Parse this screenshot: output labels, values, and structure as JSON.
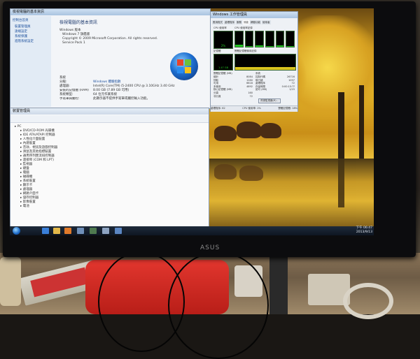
{
  "system_window": {
    "title": "檢視電腦的基本資訊",
    "section_edition": "Windows 版本",
    "edition": "Windows 7 旗艦版",
    "copyright": "Copyright © 2009 Microsoft Corporation. All rights reserved.",
    "service_pack": "Service Pack 1",
    "section_system": "系統",
    "rating_label": "分級:",
    "rating_value": "Windows 體驗指數",
    "processor_label": "處理器:",
    "processor_value": "Intel(R) Core(TM) i5-2400 CPU @ 3.10GHz 3.40 GHz",
    "memory_label": "安裝的記憶體 (RAM):",
    "memory_value": "8.00 GB (7.89 GB 可用)",
    "type_label": "系統類型:",
    "type_value": "64 位元作業系統",
    "pen_label": "手寫筆與觸控:",
    "pen_value": "此顯示器不提供手寫筆或觸控輸入功能。",
    "sidebar": [
      "控制台首頁",
      "裝置管理員",
      "遠端設定",
      "系統保護",
      "進階系統設定"
    ]
  },
  "device_manager": {
    "title": "裝置管理員",
    "items": [
      "DVD/CD-ROM 光碟機",
      "IDE ATA/ATAPI 控制器",
      "人性化介面裝置",
      "內建裝置",
      "音效、視訊及遊戲控制器",
      "滑鼠及其他指標裝置",
      "通用序列匯流排控制器",
      "連接埠 (COM 和 LPT)",
      "監視器",
      "鍵盤",
      "電腦",
      "磁碟機",
      "系統裝置",
      "顯示卡",
      "處理器",
      "網路介面卡",
      "儲存控制器",
      "影像裝置",
      "電池"
    ]
  },
  "task_manager": {
    "title": "Windows 工作管理員",
    "tabs": [
      "應用程式",
      "處理程序",
      "服務",
      "效能",
      "網路功能",
      "使用者"
    ],
    "cpu_usage_label": "CPU 使用率",
    "cpu_history_label": "CPU 使用率記錄",
    "cpu_usage_value": "2%",
    "memory_label": "記憶體",
    "memory_history_label": "實體記憶體使用記錄",
    "memory_value": "1.47 GB",
    "phys_label": "實體記憶體 (MB)",
    "phys_rows": [
      [
        "總計",
        "8084"
      ],
      [
        "快取",
        "1280"
      ],
      [
        "可用",
        "6618"
      ],
      [
        "未使用",
        "4892"
      ]
    ],
    "system_label": "系統",
    "system_rows": [
      [
        "控制代碼",
        "26716"
      ],
      [
        "執行緒",
        "1097"
      ],
      [
        "處理程序",
        "72"
      ],
      [
        "存留時間",
        "0:00:15:??"
      ],
      [
        "認可 (MB)",
        "1/15"
      ]
    ],
    "kernel_label": "核心記憶體 (MB)",
    "kernel_rows": [
      [
        "分頁",
        "160"
      ],
      [
        "非分頁",
        "72"
      ]
    ],
    "resource_button": "資源監視器(R)...",
    "status_processes": "處理程序: 62",
    "status_cpu": "CPU 使用率: 2%",
    "status_memory": "實體記憶體: 18%",
    "cpu_history": [
      0.12,
      0.05,
      0.08,
      0.03,
      0.1,
      0.04
    ],
    "mem_history": [
      0.18,
      0.18,
      0.18,
      0.18,
      0.18,
      0.18
    ]
  },
  "taskbar": {
    "time": "下午 06:47",
    "date": "2013/9/13"
  },
  "monitor": {
    "brand": "ASUS"
  },
  "colors": {
    "accent": "#1c4f9c",
    "graph": "#22c322",
    "taskbar": "#0e1622"
  },
  "icons": [
    "windows-logo-icon",
    "start-orb-icon",
    "folder-icon",
    "ie-icon",
    "computer-icon",
    "tree-node-icon"
  ]
}
